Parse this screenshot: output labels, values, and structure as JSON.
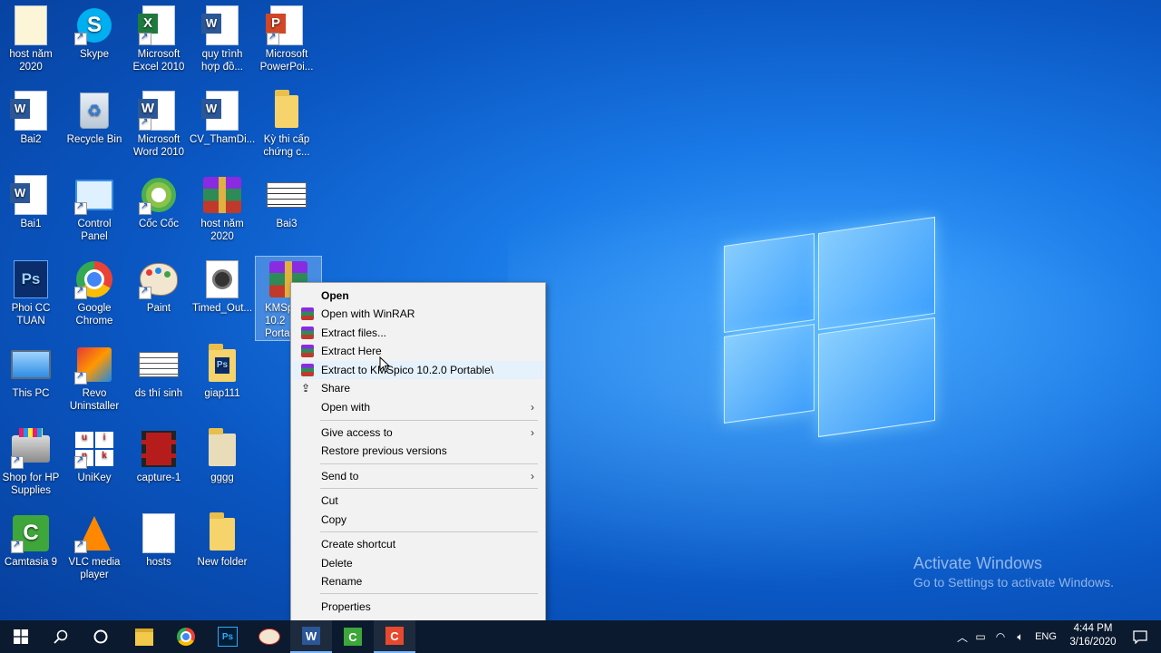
{
  "desktop_icons": [
    {
      "label": "host năm\n2020"
    },
    {
      "label": "Skype"
    },
    {
      "label": "Microsoft\nExcel 2010"
    },
    {
      "label": "quy trình\nhợp đồ..."
    },
    {
      "label": "Microsoft\nPowerPoi..."
    },
    {
      "label": "Bai2"
    },
    {
      "label": "Recycle Bin"
    },
    {
      "label": "Microsoft\nWord 2010"
    },
    {
      "label": "CV_ThamDi..."
    },
    {
      "label": "Kỳ thi cấp\nchứng c..."
    },
    {
      "label": "Bai1"
    },
    {
      "label": "Control\nPanel"
    },
    {
      "label": "Cốc Cốc"
    },
    {
      "label": "host năm\n2020"
    },
    {
      "label": "Bai3"
    },
    {
      "label": "Phoi CC\nTUAN"
    },
    {
      "label": "Google\nChrome"
    },
    {
      "label": "Paint"
    },
    {
      "label": "Timed_Out..."
    },
    {
      "label": "KMSp\n10.2\nPorta"
    },
    {
      "label": "This PC"
    },
    {
      "label": "Revo\nUninstaller"
    },
    {
      "label": "ds thí sinh"
    },
    {
      "label": "giap111"
    },
    {
      "label": "Shop for HP\nSupplies"
    },
    {
      "label": "UniKey"
    },
    {
      "label": "capture-1"
    },
    {
      "label": "gggg"
    },
    {
      "label": "Camtasia 9"
    },
    {
      "label": "VLC media\nplayer"
    },
    {
      "label": "hosts"
    },
    {
      "label": "New folder"
    }
  ],
  "context_menu": {
    "open": "Open",
    "open_with_winrar": "Open with WinRAR",
    "extract_files": "Extract files...",
    "extract_here": "Extract Here",
    "extract_to": "Extract to KMSpico 10.2.0 Portable\\",
    "share": "Share",
    "open_with": "Open with",
    "give_access": "Give access to",
    "restore_versions": "Restore previous versions",
    "send_to": "Send to",
    "cut": "Cut",
    "copy": "Copy",
    "create_shortcut": "Create shortcut",
    "delete": "Delete",
    "rename": "Rename",
    "properties": "Properties"
  },
  "watermark": {
    "title": "Activate Windows",
    "subtitle": "Go to Settings to activate Windows."
  },
  "taskbar": {
    "language": "ENG",
    "time": "4:44 PM",
    "date": "3/16/2020"
  },
  "colors": {
    "taskbar_bg": "#0b1a2e",
    "menu_bg": "#f2f2f2",
    "menu_hover": "#e5f1fb",
    "desktop_blue": "#1979e6"
  }
}
